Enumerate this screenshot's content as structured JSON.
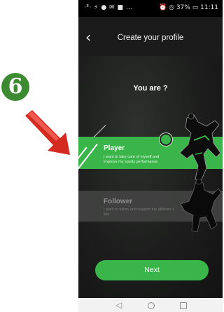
{
  "annotation": {
    "step_number": "6"
  },
  "status_bar": {
    "left": "·ᴱ· ⚡ ● ✉ ■ …",
    "right": "⏰ ◎ 37% ▭ 11:11"
  },
  "header": {
    "title": "Create your profile"
  },
  "question": "You are ?",
  "options": {
    "player": {
      "title": "Player",
      "description": "I want to take care of myself and improve my sports performance"
    },
    "follower": {
      "title": "Follower",
      "description": "I want to follow and support the athletes I like"
    }
  },
  "next_label": "Next",
  "colors": {
    "accent": "#3ab54a",
    "background": "#151515",
    "annotation": "#3c8a32",
    "arrow": "#d42a20"
  }
}
